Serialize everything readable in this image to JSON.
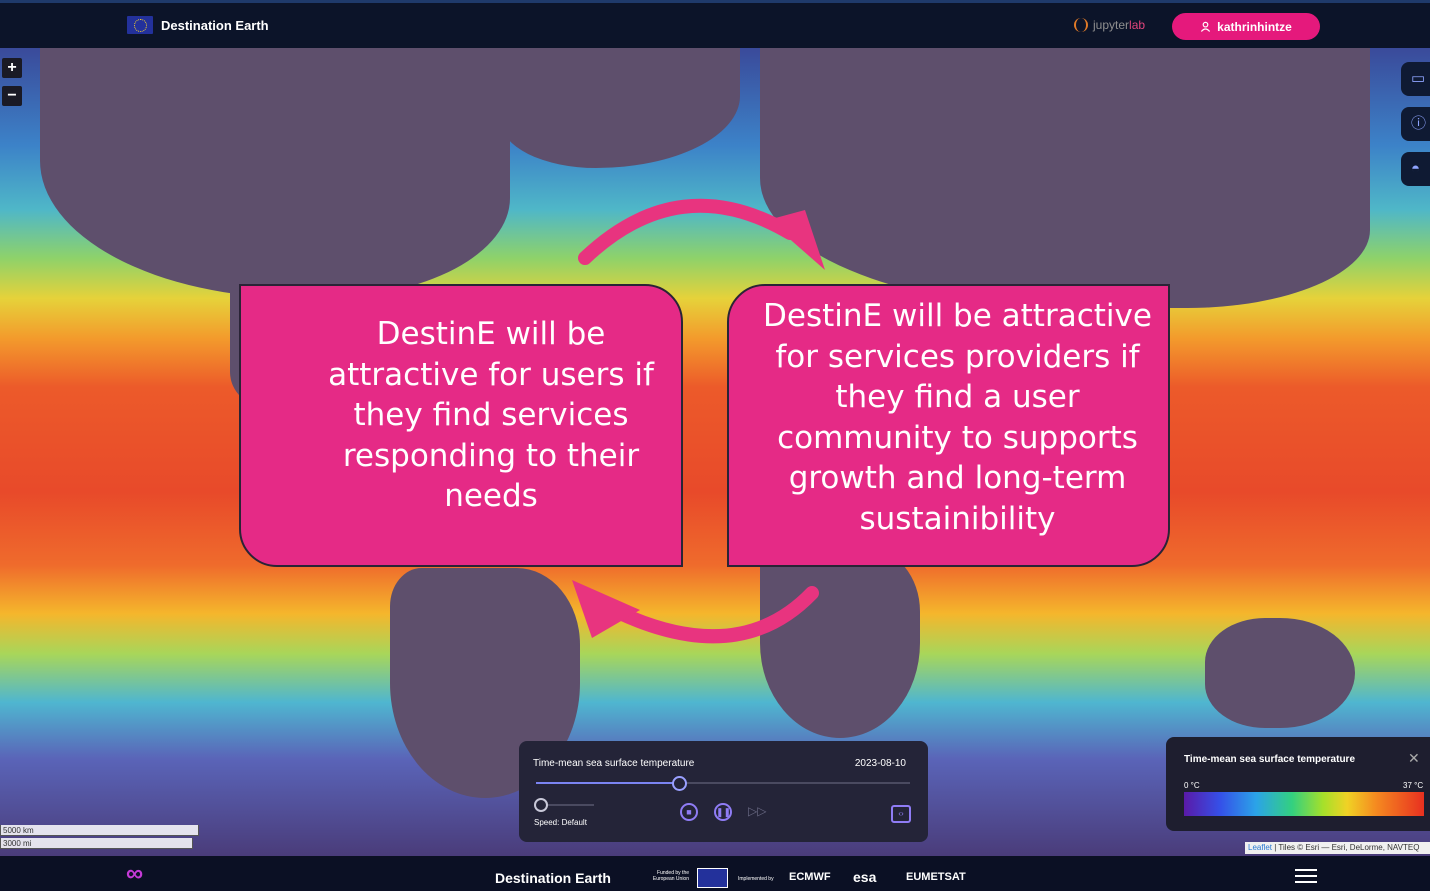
{
  "header": {
    "brand": "Destination Earth",
    "jupyter_prefix": "jupyter",
    "jupyter_suffix": "lab",
    "user": "kathrinhintze"
  },
  "map": {
    "zoom_in": "+",
    "zoom_out": "−",
    "scale_km": "5000 km",
    "scale_mi": "3000 mi",
    "attribution_link": "Leaflet",
    "attribution_text": "| Tiles © Esri — Esri, DeLorme, NAVTEQ"
  },
  "bubbles": {
    "users": "DestinE will be attractive for users if they find services responding to their needs",
    "providers": "DestinE will be attractive for services providers if they find a user community to supports growth and long-term sustainibility"
  },
  "time_panel": {
    "title": "Time-mean sea surface temperature",
    "date": "2023-08-10",
    "speed": "Speed: Default",
    "progress": 0.38
  },
  "legend": {
    "title": "Time-mean sea surface temperature",
    "min": "0 °C",
    "max": "37 °C"
  },
  "footer": {
    "title": "Destination Earth",
    "funded_by": "Funded by the European Union",
    "implemented_by": "Implemented by",
    "orgs": [
      "ECMWF",
      "esa",
      "EUMETSAT"
    ]
  },
  "colors": {
    "accent": "#e5197c",
    "bubble": "#e52a86",
    "arrow": "#e8347f"
  }
}
